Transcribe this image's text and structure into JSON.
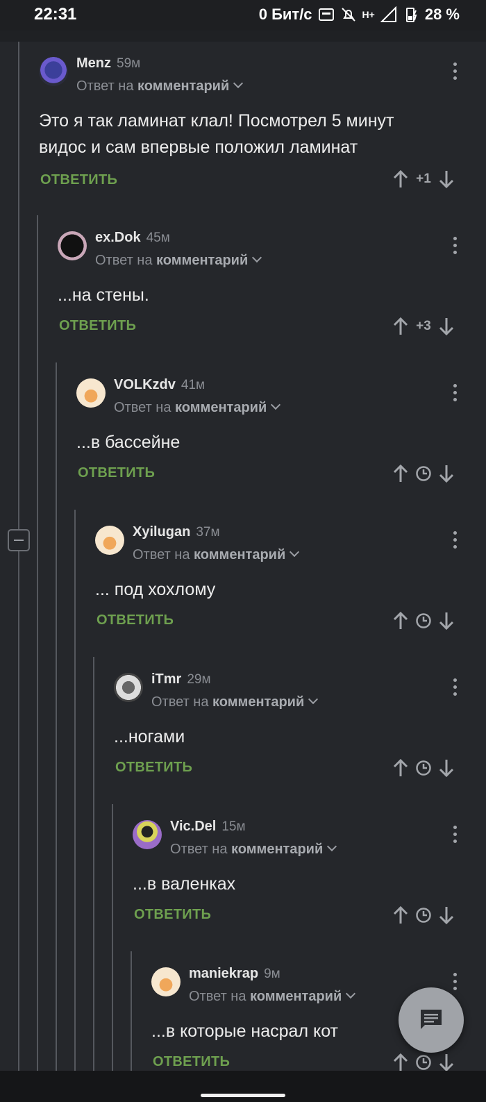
{
  "status": {
    "time": "22:31",
    "speed": "0 Бит/с",
    "battery": "28 %",
    "network": "H+",
    "icons": [
      "hz-icon",
      "bell-off-icon",
      "signal-icon",
      "battery-charging-icon"
    ]
  },
  "reply_label": "ОТВЕТИТЬ",
  "reply_to_prefix": "Ответ на",
  "reply_to_target": "комментарий",
  "comments": [
    {
      "author": "Menz",
      "time": "59м",
      "text1": "Это я так ламинат клал! Посмотрел 5 минут",
      "text2": "видос и сам впервые положил ламинат",
      "score": "+1"
    },
    {
      "author": "ex.Dok",
      "time": "45м",
      "text1": "...на стены.",
      "score": "+3"
    },
    {
      "author": "VOLKzdv",
      "time": "41м",
      "text1": "...в бассейне"
    },
    {
      "author": "Xyilugan",
      "time": "37м",
      "text1": "... под хохлому"
    },
    {
      "author": "iTmr",
      "time": "29м",
      "text1": "...ногами"
    },
    {
      "author": "Vic.Del",
      "time": "15м",
      "text1": "...в валенках"
    },
    {
      "author": "maniekrap",
      "time": "9м",
      "text1": "...в которые насрал кот"
    }
  ],
  "colors": {
    "background": "#25272b",
    "reply": "#6ea04f",
    "text": "#ececec",
    "muted": "#8a8d93"
  }
}
